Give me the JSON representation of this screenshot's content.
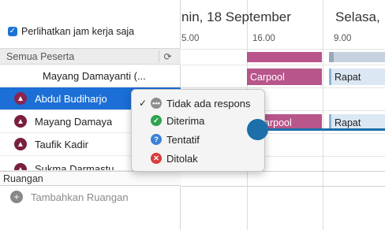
{
  "left_panel": {
    "show_work_hours_label": "Perlihatkan jam kerja saja",
    "participants_header": "Semua Peserta",
    "participants": [
      {
        "name": "Mayang Damayanti (...",
        "avatar": false,
        "selected": false
      },
      {
        "name": "Abdul Budiharjo",
        "avatar": true,
        "selected": true
      },
      {
        "name": "Mayang Damaya",
        "avatar": true,
        "selected": false
      },
      {
        "name": "Taufik Kadir",
        "avatar": true,
        "selected": false
      },
      {
        "name": "Sukma Darmastu...",
        "avatar": true,
        "selected": false
      }
    ],
    "rooms_header": "Ruangan",
    "add_room_label": "Tambahkan Ruangan"
  },
  "calendar": {
    "day1_title": "nin, 18 September",
    "day2_title": "Selasa,",
    "time_labels": [
      "5.00",
      "16.00",
      "9.00"
    ],
    "events": {
      "carpool_label": "Carpool",
      "rapat_label": "Rapat",
      "carpool2_label": "arpool",
      "rapat2_label": "Rapat"
    }
  },
  "response_menu": {
    "items": [
      {
        "label": "Tidak ada respons",
        "checked": true,
        "icon": "no-response-icon",
        "color": "#8e8e8e",
        "glyph": "…"
      },
      {
        "label": "Diterima",
        "checked": false,
        "icon": "accepted-icon",
        "color": "#2ea44f",
        "glyph": "✓"
      },
      {
        "label": "Tentatif",
        "checked": false,
        "icon": "tentative-icon",
        "color": "#3b82d6",
        "glyph": "?"
      },
      {
        "label": "Ditolak",
        "checked": false,
        "icon": "declined-icon",
        "color": "#d93b3b",
        "glyph": "✕"
      }
    ]
  },
  "colors": {
    "selection": "#1b6fd6",
    "event_pink": "#b8558b",
    "event_blue": "#dbe8f3",
    "connector": "#1c6fa8"
  }
}
